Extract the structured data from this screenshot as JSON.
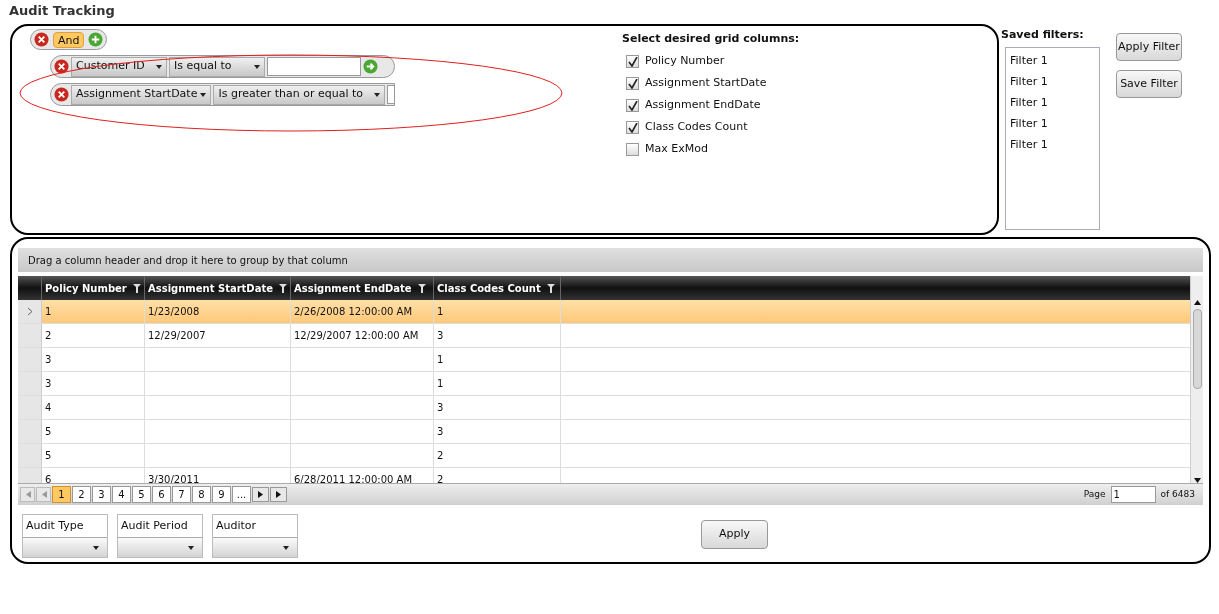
{
  "page_title": "Audit Tracking",
  "filter_builder": {
    "operator": "And",
    "conditions": [
      {
        "field": "Customer ID",
        "operator": "Is equal to"
      },
      {
        "field": "Assignment StartDate",
        "operator": "Is greater than or equal to"
      }
    ]
  },
  "column_chooser": {
    "title": "Select desired grid columns:",
    "columns": [
      {
        "label": "Policy Number",
        "checked": true
      },
      {
        "label": "Assignment StartDate",
        "checked": true
      },
      {
        "label": "Assignment EndDate",
        "checked": true
      },
      {
        "label": "Class Codes Count",
        "checked": true
      },
      {
        "label": "Max ExMod",
        "checked": false
      }
    ]
  },
  "saved_filters": {
    "title": "Saved filters:",
    "items": [
      "Filter 1",
      "Filter 1",
      "Filter 1",
      "Filter 1",
      "Filter 1"
    ]
  },
  "filter_buttons": [
    "Apply Filter",
    "Save Filter"
  ],
  "grid": {
    "group_hint": "Drag a column header and drop it here to group by that column",
    "columns": [
      "Policy Number",
      "Assignment StartDate",
      "Assignment EndDate",
      "Class Codes Count"
    ],
    "rows": [
      {
        "selected": true,
        "cells": [
          "1",
          "1/23/2008",
          "2/26/2008 12:00:00 AM",
          "1"
        ]
      },
      {
        "selected": false,
        "cells": [
          "2",
          "12/29/2007",
          "12/29/2007 12:00:00 AM",
          "3"
        ]
      },
      {
        "selected": false,
        "cells": [
          "3",
          "",
          "",
          "1"
        ]
      },
      {
        "selected": false,
        "cells": [
          "3",
          "",
          "",
          "1"
        ]
      },
      {
        "selected": false,
        "cells": [
          "4",
          "",
          "",
          "3"
        ]
      },
      {
        "selected": false,
        "cells": [
          "5",
          "",
          "",
          "3"
        ]
      },
      {
        "selected": false,
        "cells": [
          "5",
          "",
          "",
          "2"
        ]
      },
      {
        "selected": false,
        "cells": [
          "6",
          "3/30/2011",
          "6/28/2011 12:00:00 AM",
          "2"
        ]
      }
    ]
  },
  "pager": {
    "pages": [
      {
        "label": "1",
        "selected": true
      },
      {
        "label": "2",
        "selected": false
      },
      {
        "label": "3",
        "selected": false
      },
      {
        "label": "4",
        "selected": false
      },
      {
        "label": "5",
        "selected": false
      },
      {
        "label": "6",
        "selected": false
      },
      {
        "label": "7",
        "selected": false
      },
      {
        "label": "8",
        "selected": false
      },
      {
        "label": "9",
        "selected": false
      },
      {
        "label": "...",
        "selected": false
      }
    ],
    "page_label": "Page",
    "page_value": "1",
    "total": "of 6483"
  },
  "dropdowns": [
    {
      "label": "Audit Type"
    },
    {
      "label": "Audit Period"
    },
    {
      "label": "Auditor"
    }
  ],
  "apply_button": "Apply"
}
